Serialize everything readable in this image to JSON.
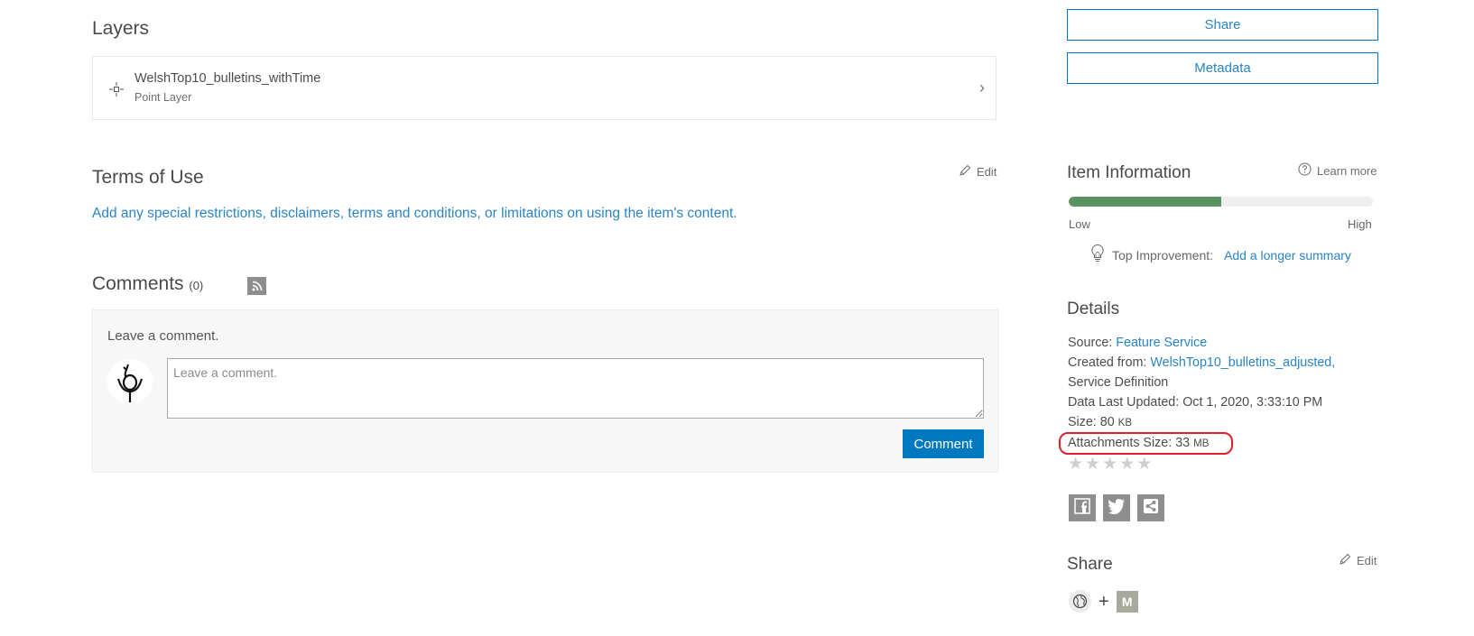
{
  "layers": {
    "title": "Layers",
    "items": [
      {
        "name": "WelshTop10_bulletins_withTime",
        "type": "Point Layer",
        "icon": "point-layer-icon"
      }
    ]
  },
  "terms": {
    "title": "Terms of Use",
    "edit_label": "Edit",
    "placeholder_link": "Add any special restrictions, disclaimers, terms and conditions, or limitations on using the item's content."
  },
  "comments": {
    "title": "Comments",
    "count": "(0)",
    "prompt": "Leave a comment.",
    "input_placeholder": "Leave a comment.",
    "input_value": "",
    "submit_label": "Comment"
  },
  "actions": {
    "share_label": "Share",
    "metadata_label": "Metadata"
  },
  "item_information": {
    "title": "Item Information",
    "learn_more_label": "Learn more",
    "score_fraction": 0.5,
    "low_label": "Low",
    "high_label": "High",
    "top_improvement_label": "Top Improvement:",
    "top_improvement_link": "Add a longer summary",
    "fill_color": "#5a9360"
  },
  "details": {
    "title": "Details",
    "source_label": "Source:",
    "source_value": "Feature Service",
    "created_from_label": "Created from:",
    "created_from_value": "WelshTop10_bulletins_adjusted,",
    "created_from_type": "Service Definition",
    "data_last_updated_label": "Data Last Updated:",
    "data_last_updated_value": "Oct 1, 2020, 3:33:10 PM",
    "size_label": "Size:",
    "size_value": "80",
    "size_unit": "KB",
    "attachments_label": "Attachments Size:",
    "attachments_value": "33",
    "attachments_unit": "MB",
    "rating": {
      "value": 0,
      "max": 5
    },
    "highlight_color": "#e0202a"
  },
  "social": [
    {
      "name": "facebook",
      "icon": "facebook-icon"
    },
    {
      "name": "twitter",
      "icon": "twitter-icon"
    },
    {
      "name": "share-link",
      "icon": "share-icon"
    }
  ],
  "share": {
    "title": "Share",
    "edit_label": "Edit",
    "plus": "+",
    "member_initial": "M"
  },
  "colors": {
    "accent": "#0079c1",
    "link": "#2a84c3"
  }
}
